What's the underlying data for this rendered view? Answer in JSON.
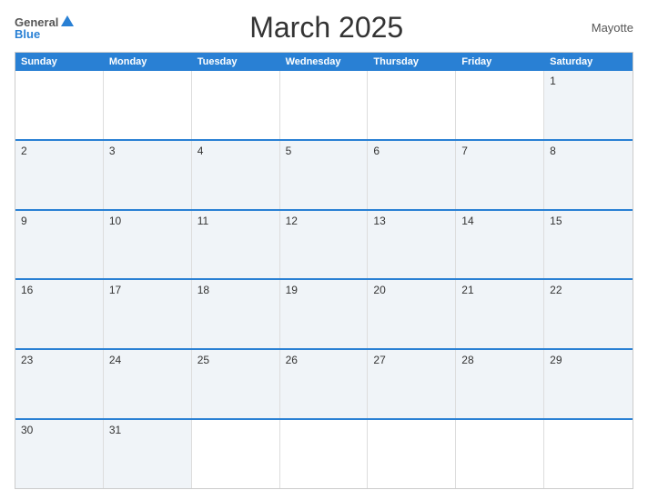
{
  "header": {
    "title": "March 2025",
    "region": "Mayotte",
    "logo": {
      "general": "General",
      "blue": "Blue"
    }
  },
  "calendar": {
    "days": [
      "Sunday",
      "Monday",
      "Tuesday",
      "Wednesday",
      "Thursday",
      "Friday",
      "Saturday"
    ],
    "weeks": [
      [
        null,
        null,
        null,
        null,
        null,
        null,
        1
      ],
      [
        2,
        3,
        4,
        5,
        6,
        7,
        8
      ],
      [
        9,
        10,
        11,
        12,
        13,
        14,
        15
      ],
      [
        16,
        17,
        18,
        19,
        20,
        21,
        22
      ],
      [
        23,
        24,
        25,
        26,
        27,
        28,
        29
      ],
      [
        30,
        31,
        null,
        null,
        null,
        null,
        null
      ]
    ]
  }
}
